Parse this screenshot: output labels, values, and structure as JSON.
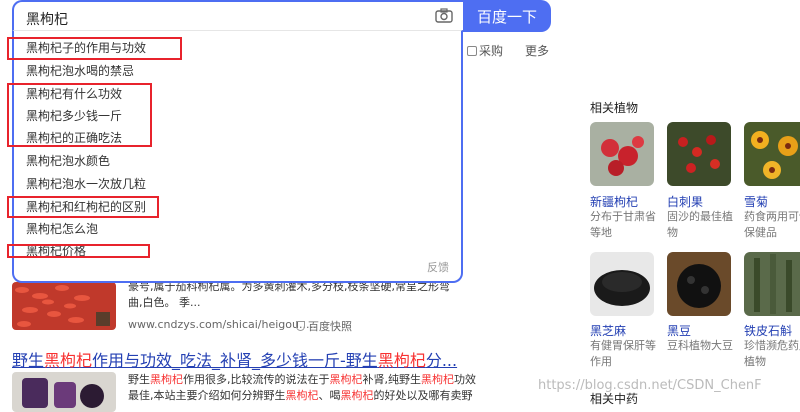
{
  "search": {
    "query": "黑枸杞",
    "button_label": "百度一下"
  },
  "nav": {
    "purchase_label": "采购",
    "more_label": "更多"
  },
  "suggestions": [
    "黑枸杞子的作用与功效",
    "黑枸杞泡水喝的禁忌",
    "黑枸杞有什么功效",
    "黑枸杞多少钱一斤",
    "黑枸杞的正确吃法",
    "黑枸杞泡水颜色",
    "黑枸杞泡水一次放几粒",
    "黑枸杞和红枸杞的区别",
    "黑枸杞怎么泡",
    "黑枸杞价格"
  ],
  "dropdown_footer": "反馈",
  "result1": {
    "snippet_line1": "豪号,属于茄科枸杞属。为多黄刺灌木,多分枝,枝条坚硬,常呈之形弯",
    "snippet_line2": "曲,白色。 季...",
    "url": "www.cndzys.com/shicai/heigou.....",
    "snapshot": "百度快照"
  },
  "result2": {
    "title_pre": "野生",
    "title_hl1": "黑枸杞",
    "title_mid": "作用与功效_吃法_补肾_多少钱一斤-野生",
    "title_hl2": "黑枸杞",
    "title_post": "分...",
    "line1_a": "野生",
    "line1_hl1": "黑枸杞",
    "line1_b": "作用很多,比较流传的说法在于",
    "line1_hl2": "黑枸杞",
    "line1_c": "补肾,纯野生",
    "line1_hl3": "黑枸杞",
    "line1_d": "功效",
    "line2_a": "最佳,本站主要介绍如何分辨野生",
    "line2_hl1": "黑枸杞",
    "line2_b": "、喝",
    "line2_hl2": "黑枸杞",
    "line2_c": "的好处以及哪有卖野"
  },
  "right_panel": {
    "title": "相关植物",
    "plants": [
      {
        "name": "新疆枸杞",
        "desc1": "分布于甘肃省",
        "desc2": "等地"
      },
      {
        "name": "白刺果",
        "desc1": "固沙的最佳植",
        "desc2": "物"
      },
      {
        "name": "雪菊",
        "desc1": "药食两用可饮",
        "desc2": "保健品"
      },
      {
        "name": "黑芝麻",
        "desc1": "有健胃保肝等",
        "desc2": "作用"
      },
      {
        "name": "黑豆",
        "desc1": "豆科植物大豆",
        "desc2": ""
      },
      {
        "name": "铁皮石斛",
        "desc1": "珍惜濒危药用",
        "desc2": "植物"
      }
    ],
    "title2": "相关中药"
  },
  "watermark": "https://blog.csdn.net/CSDN_ChenF",
  "colors": {
    "brand_blue": "#4e6ef2",
    "highlight_red": "#f73131",
    "annotation_red": "#e8232c",
    "link_blue": "#2440b3"
  }
}
